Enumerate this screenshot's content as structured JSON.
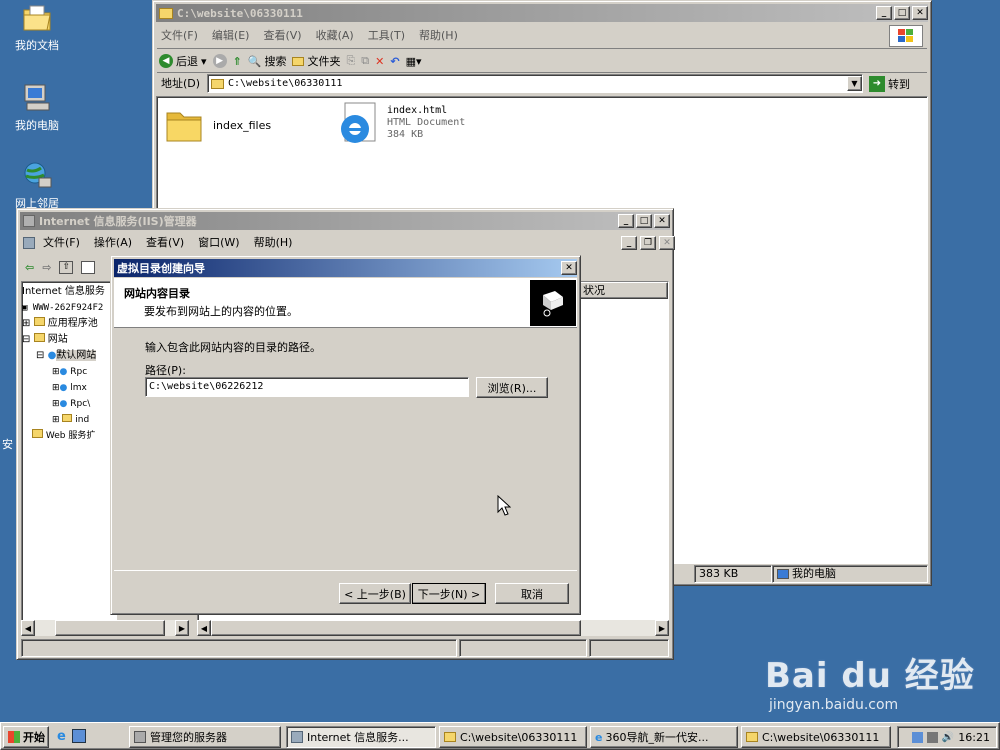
{
  "desktop": {
    "icons": [
      {
        "label": "我的文档"
      },
      {
        "label": "我的电脑"
      },
      {
        "label": "网上邻居"
      }
    ],
    "partial_label": "安"
  },
  "explorer": {
    "title": "C:\\website\\06330111",
    "menu": [
      "文件(F)",
      "编辑(E)",
      "查看(V)",
      "收藏(A)",
      "工具(T)",
      "帮助(H)"
    ],
    "toolbar": {
      "back": "后退",
      "search": "搜索",
      "folders": "文件夹"
    },
    "address_label": "地址(D)",
    "address_value": "C:\\website\\06330111",
    "go": "转到",
    "files": [
      {
        "name": "index_files"
      },
      {
        "name": "index.html",
        "type": "HTML Document",
        "size": "384 KB"
      }
    ],
    "status": {
      "size": "383 KB",
      "location": "我的电脑"
    }
  },
  "iis": {
    "title": "Internet 信息服务(IIS)管理器",
    "menu": [
      "文件(F)",
      "操作(A)",
      "查看(V)",
      "窗口(W)",
      "帮助(H)"
    ],
    "tree": [
      "Internet 信息服务",
      "WWW-262F924F2",
      "应用程序池",
      "网站",
      "默认网站",
      "Rpc",
      "lmx",
      "Rpc\\",
      "ind",
      "Web 服务扩"
    ],
    "right_header": "状况"
  },
  "wizard": {
    "title": "虚拟目录创建向导",
    "header_title": "网站内容目录",
    "header_subtitle": "要发布到网站上的内容的位置。",
    "instruction": "输入包含此网站内容的目录的路径。",
    "path_label": "路径(P):",
    "path_value": "C:\\website\\06226212",
    "browse": "浏览(R)...",
    "back": "< 上一步(B)",
    "next": "下一步(N) >",
    "cancel": "取消"
  },
  "taskbar": {
    "start": "开始",
    "tasks": [
      "管理您的服务器",
      "Internet 信息服务...",
      "C:\\website\\06330111",
      "360导航_新一代安...",
      "C:\\website\\06330111"
    ],
    "clock": "16:21"
  },
  "watermark": {
    "brand": "Bai du 经验",
    "url": "jingyan.baidu.com"
  }
}
